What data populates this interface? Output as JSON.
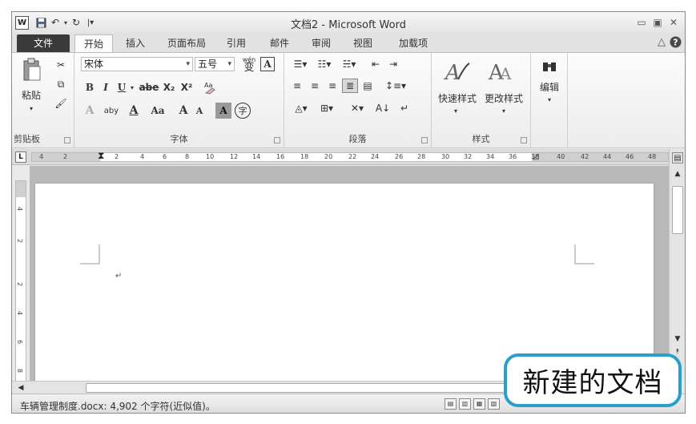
{
  "window": {
    "title": "文档2 - Microsoft Word",
    "logo": "W"
  },
  "quick_access": {
    "icons": [
      "save-icon",
      "undo-icon",
      "redo-icon",
      "customize-icon"
    ]
  },
  "tabs": [
    {
      "label": "文件",
      "active": false
    },
    {
      "label": "开始",
      "active": true
    },
    {
      "label": "插入",
      "active": false
    },
    {
      "label": "页面布局",
      "active": false
    },
    {
      "label": "引用",
      "active": false
    },
    {
      "label": "邮件",
      "active": false
    },
    {
      "label": "审阅",
      "active": false
    },
    {
      "label": "视图",
      "active": false
    },
    {
      "label": "加载项",
      "active": false
    }
  ],
  "ribbon": {
    "clipboard": {
      "paste_label": "粘贴",
      "group_label": "剪贴板"
    },
    "font": {
      "font_name": "宋体",
      "font_size": "五号",
      "phonetic_glyph": "wén",
      "phonetic_char": "变",
      "border_char": "A",
      "bold": "B",
      "italic": "I",
      "underline": "U",
      "strike": "abe",
      "sub": "X₂",
      "sup": "X²",
      "text_effect": "A",
      "highlight": "aby",
      "font_color": "A",
      "change_case": "Aa",
      "grow": "A",
      "shrink": "A",
      "char_shading": "A",
      "enclose": "字",
      "group_label": "字体"
    },
    "paragraph": {
      "group_label": "段落"
    },
    "styles": {
      "quick_styles_label": "快速样式",
      "change_styles_label": "更改样式",
      "group_label": "样式"
    },
    "editing": {
      "label": "编辑"
    }
  },
  "ruler": {
    "h_labels": [
      "4",
      "2",
      "2",
      "4",
      "6",
      "8",
      "10",
      "12",
      "14",
      "16",
      "18",
      "20",
      "22",
      "24",
      "26",
      "28",
      "30",
      "32",
      "34",
      "36",
      "38",
      "40",
      "42",
      "44",
      "46",
      "48"
    ],
    "v_labels": [
      "4",
      "2",
      "2",
      "4",
      "6",
      "8"
    ]
  },
  "status": {
    "text": "车辆管理制度.docx: 4,902 个字符(近似值)。"
  },
  "callout": {
    "text": "新建的文档"
  },
  "colors": {
    "accent": "#2aa0c9",
    "file_tab": "#3a3a3a"
  }
}
